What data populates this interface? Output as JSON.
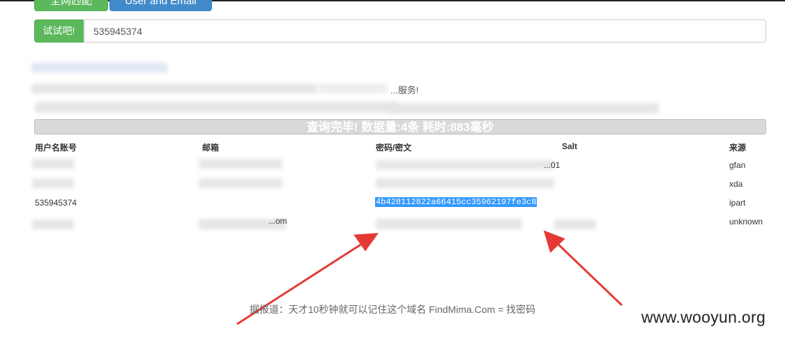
{
  "toolbar": {
    "left_tab_label": "全网匹配",
    "user_email_tab_label": "User and Email"
  },
  "search": {
    "button_label": "试试吧!",
    "value": "535945374"
  },
  "notice": {
    "line2_visible_tail": "...服务!"
  },
  "status": {
    "text": "查询完毕! 数据量:4条 耗时:883毫秒"
  },
  "table": {
    "headers": [
      "用户名账号",
      "邮箱",
      "密码/密文",
      "Salt",
      "来源"
    ],
    "rows": [
      {
        "username": "",
        "email": "",
        "password": "...01",
        "salt": "",
        "source": "gfan"
      },
      {
        "username": "",
        "email": "",
        "password": "",
        "salt": "",
        "source": "xda"
      },
      {
        "username": "535945374",
        "email": "",
        "password": "4b428112822a66415cc35962197fe3c8",
        "salt": "",
        "source": "ipart"
      },
      {
        "username": "",
        "email": "...om",
        "password": "",
        "salt": "",
        "source": "unknown"
      }
    ]
  },
  "footer": {
    "note": "据报道：天才10秒钟就可以记住这个域名 FindMima.Com = 找密码"
  },
  "watermark": "www.wooyun.org",
  "colors": {
    "primary_green": "#5cb85c",
    "primary_blue": "#428bca",
    "highlight": "#3399ff",
    "arrow_red": "#e53935"
  }
}
